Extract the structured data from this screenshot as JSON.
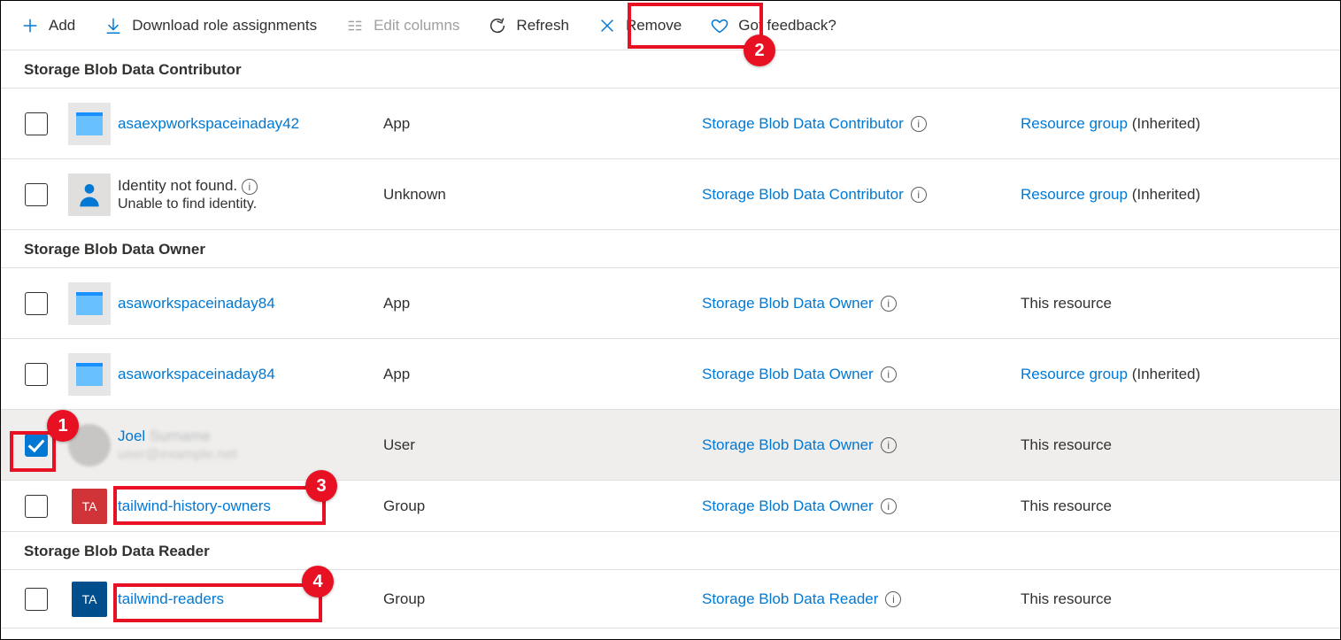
{
  "toolbar": {
    "add": "Add",
    "download": "Download role assignments",
    "edit_columns": "Edit columns",
    "refresh": "Refresh",
    "remove": "Remove",
    "feedback": "Got feedback?"
  },
  "groups": {
    "contributor": "Storage Blob Data Contributor",
    "owner": "Storage Blob Data Owner",
    "reader": "Storage Blob Data Reader"
  },
  "rows": {
    "r1": {
      "name": "asaexpworkspaceinaday42",
      "type": "App",
      "role": "Storage Blob Data Contributor",
      "scope_link": "Resource group",
      "scope_suffix": " (Inherited)"
    },
    "r2": {
      "name_line1": "Identity not found.",
      "name_line2": "Unable to find identity.",
      "type": "Unknown",
      "role": "Storage Blob Data Contributor",
      "scope_link": "Resource group",
      "scope_suffix": " (Inherited)"
    },
    "r3": {
      "name": "asaworkspaceinaday84",
      "type": "App",
      "role": "Storage Blob Data Owner",
      "scope_plain": "This resource"
    },
    "r4": {
      "name": "asaworkspaceinaday84",
      "type": "App",
      "role": "Storage Blob Data Owner",
      "scope_link": "Resource group",
      "scope_suffix": " (Inherited)"
    },
    "r5": {
      "name": "Joel",
      "type": "User",
      "role": "Storage Blob Data Owner",
      "scope_plain": "This resource"
    },
    "r6": {
      "name": "tailwind-history-owners",
      "initials": "TA",
      "type": "Group",
      "role": "Storage Blob Data Owner",
      "scope_plain": "This resource"
    },
    "r7": {
      "name": "tailwind-readers",
      "initials": "TA",
      "type": "Group",
      "role": "Storage Blob Data Reader",
      "scope_plain": "This resource"
    }
  },
  "callouts": {
    "c1": "1",
    "c2": "2",
    "c3": "3",
    "c4": "4"
  }
}
